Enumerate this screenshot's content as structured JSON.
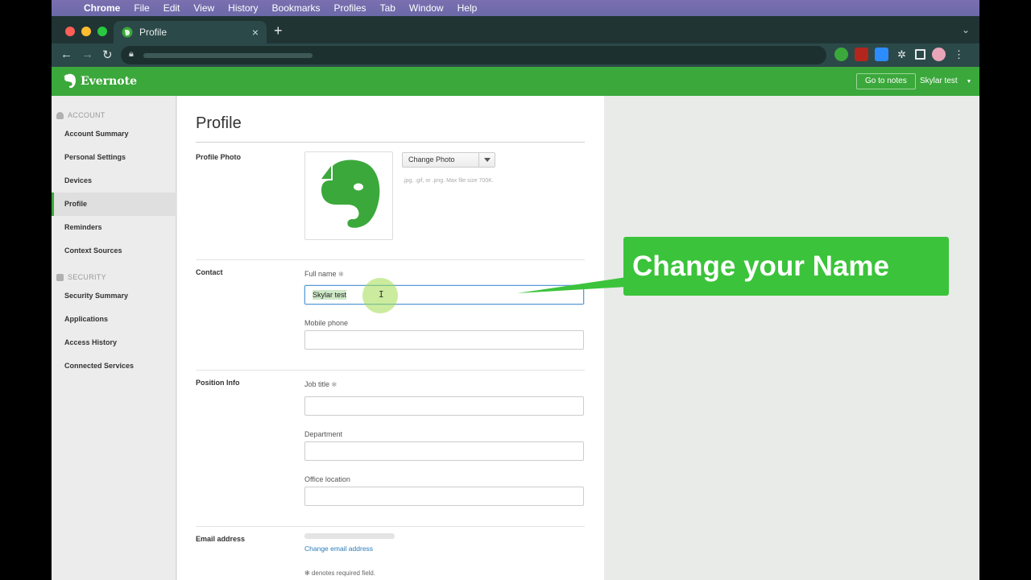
{
  "menubar": {
    "items": [
      "Chrome",
      "File",
      "Edit",
      "View",
      "History",
      "Bookmarks",
      "Profiles",
      "Tab",
      "Window",
      "Help"
    ]
  },
  "browser": {
    "tab_title": "Profile",
    "close_glyph": "×",
    "new_tab_glyph": "+"
  },
  "app": {
    "name": "Evernote",
    "go_to_notes": "Go to notes",
    "user_name": "Skylar test",
    "brand_color": "#3ba83b"
  },
  "sidebar": {
    "account_section": "ACCOUNT",
    "security_section": "SECURITY",
    "account_items": [
      "Account Summary",
      "Personal Settings",
      "Devices",
      "Profile",
      "Reminders",
      "Context Sources"
    ],
    "security_items": [
      "Security Summary",
      "Applications",
      "Access History",
      "Connected Services"
    ],
    "active_item": "Profile"
  },
  "main": {
    "title": "Profile",
    "profile_photo_label": "Profile Photo",
    "change_photo": "Change Photo",
    "photo_hint": ".jpg, .gif, or .png. Max file size 700K.",
    "contact_label": "Contact",
    "full_name_label": "Full name",
    "required_mark": "✻",
    "full_name_value": "Skylar test",
    "mobile_phone_label": "Mobile phone",
    "mobile_phone_value": "",
    "position_label": "Position Info",
    "job_title_label": "Job title",
    "job_title_value": "",
    "department_label": "Department",
    "department_value": "",
    "office_location_label": "Office location",
    "office_location_value": "",
    "email_label": "Email address",
    "change_email": "Change email address",
    "required_note": "✻ denotes required field."
  },
  "callout": {
    "text": "Change your Name"
  }
}
